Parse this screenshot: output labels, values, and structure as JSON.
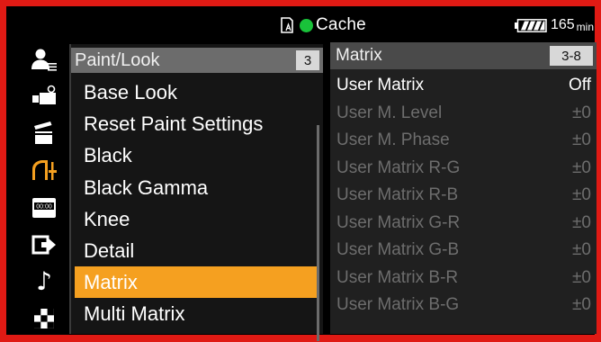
{
  "status_bar": {
    "media_icon": "media-card-icon",
    "recording_dot_color": "#19c23a",
    "cache_label": "Cache",
    "battery_icon": "battery-icon",
    "battery_value": "165",
    "battery_unit": "min"
  },
  "category_icons": [
    "user-settings-icon",
    "camera-icon",
    "clapperboard-icon",
    "paint-look-icon",
    "timecode-icon",
    "output-icon",
    "audio-note-icon",
    "checker-icon"
  ],
  "category_note_glyph": "♪",
  "menu": {
    "title": "Paint/Look",
    "page": "3",
    "items": [
      "Base Look",
      "Reset Paint Settings",
      "Black",
      "Black Gamma",
      "Knee",
      "Detail",
      "Matrix",
      "Multi Matrix"
    ],
    "selected_index": 6,
    "selected_color": "#f5a020"
  },
  "matrix_panel": {
    "title": "Matrix",
    "page": "3-8",
    "rows": [
      {
        "label": "User Matrix",
        "value": "Off"
      },
      {
        "label": "User M. Level",
        "value": "±0"
      },
      {
        "label": "User M. Phase",
        "value": "±0"
      },
      {
        "label": "User Matrix R-G",
        "value": "±0"
      },
      {
        "label": "User Matrix R-B",
        "value": "±0"
      },
      {
        "label": "User Matrix G-R",
        "value": "±0"
      },
      {
        "label": "User Matrix G-B",
        "value": "±0"
      },
      {
        "label": "User Matrix B-R",
        "value": "±0"
      },
      {
        "label": "User Matrix B-G",
        "value": "±0"
      }
    ]
  },
  "colors": {
    "frame_border": "#e01a14",
    "dim_text": "#6d6d6d"
  }
}
